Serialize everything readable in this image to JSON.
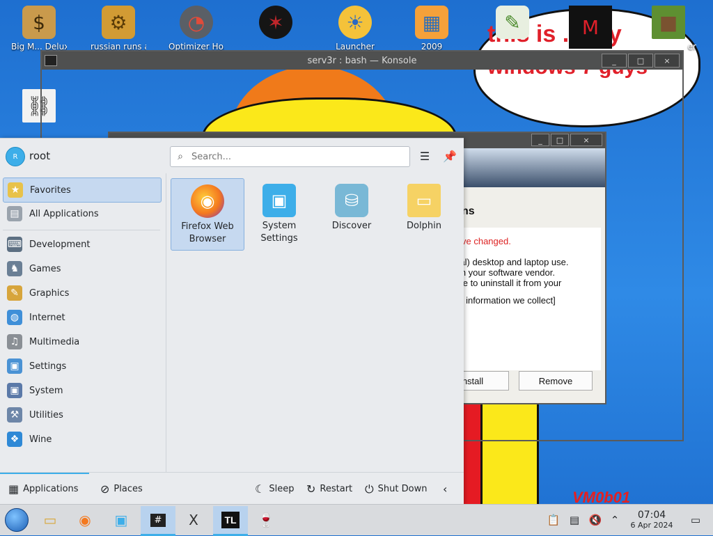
{
  "desktop": {
    "icons": [
      {
        "label": "Big M... Deluxe",
        "glyph": "$",
        "icon": "money-bag-icon"
      },
      {
        "label": "russian runs a...",
        "glyph": "⚙",
        "icon": "gear-icon"
      },
      {
        "label": "Optimizer Ho...",
        "glyph": "◔",
        "icon": "speedometer-icon"
      },
      {
        "label": "Launcher",
        "glyph": "☀",
        "icon": "launcher-icon"
      },
      {
        "label": "2009",
        "glyph": "▦",
        "icon": "office-icon"
      },
      {
        "label": "",
        "glyph": "✎",
        "icon": "notepad-shortcut-icon"
      },
      {
        "label": "",
        "glyph": "M",
        "icon": "media-player-icon"
      },
      {
        "label": "er",
        "glyph": "■",
        "icon": "minecraft-icon"
      },
      {
        "label": "",
        "glyph": "⛓",
        "icon": "shortcut-link-icon"
      }
    ],
    "wallpaper_text_1": "this is ...ally",
    "wallpaper_text_2": "windows 7 guys",
    "watermark": "VM0b01"
  },
  "konsole": {
    "title": "serv3r : bash — Konsole",
    "buttons": [
      "_",
      "□",
      "×"
    ]
  },
  "dialog": {
    "heading": "ns",
    "warning": "ve changed.",
    "body_lines": "cial) desktop and laptop use.\nom your software vendor.\nove to uninstall it from your",
    "info_line": "he information we collect]",
    "install_label": "nstall",
    "remove_label": "Remove"
  },
  "launcher": {
    "user": {
      "initial": "R",
      "name": "root"
    },
    "search": {
      "placeholder": "Search..."
    },
    "categories": [
      {
        "label": "Favorites",
        "icon": "favorites-icon",
        "glyph": "★",
        "color": "#e8c24a",
        "active": true
      },
      {
        "label": "All Applications",
        "icon": "all-apps-icon",
        "glyph": "▤",
        "color": "#9aa3ad",
        "active": false
      },
      {
        "label": "Development",
        "icon": "development-icon",
        "glyph": "⌨",
        "color": "#5c6f82",
        "active": false
      },
      {
        "label": "Games",
        "icon": "games-icon",
        "glyph": "♞",
        "color": "#6a7f95",
        "active": false
      },
      {
        "label": "Graphics",
        "icon": "graphics-icon",
        "glyph": "✎",
        "color": "#d7a53c",
        "active": false
      },
      {
        "label": "Internet",
        "icon": "internet-icon",
        "glyph": "◍",
        "color": "#3f8fd8",
        "active": false
      },
      {
        "label": "Multimedia",
        "icon": "multimedia-icon",
        "glyph": "♫",
        "color": "#8a8f95",
        "active": false
      },
      {
        "label": "Settings",
        "icon": "settings-icon",
        "glyph": "▣",
        "color": "#4a92d4",
        "active": false
      },
      {
        "label": "System",
        "icon": "system-icon",
        "glyph": "▣",
        "color": "#5b79a8",
        "active": false
      },
      {
        "label": "Utilities",
        "icon": "utilities-icon",
        "glyph": "⚒",
        "color": "#6d86a8",
        "active": false
      },
      {
        "label": "Wine",
        "icon": "wine-icon",
        "glyph": "❖",
        "color": "#2f89d6",
        "active": false
      }
    ],
    "favorites": [
      {
        "label": "Firefox Web Browser",
        "icon": "firefox-icon",
        "glyph": "◉",
        "color": "#f4791f",
        "active": true
      },
      {
        "label": "System Settings",
        "icon": "system-settings-icon",
        "glyph": "▣",
        "color": "#3daee9",
        "active": false
      },
      {
        "label": "Discover",
        "icon": "discover-icon",
        "glyph": "⛁",
        "color": "#79b8d6",
        "active": false
      },
      {
        "label": "Dolphin",
        "icon": "dolphin-folder-icon",
        "glyph": "▭",
        "color": "#f6d264",
        "active": false
      }
    ],
    "footer": {
      "applications": "Applications",
      "places": "Places",
      "sleep": "Sleep",
      "restart": "Restart",
      "shutdown": "Shut Down"
    }
  },
  "taskbar": {
    "items": [
      {
        "icon": "start-menu-icon",
        "glyph": ""
      },
      {
        "icon": "file-explorer-icon",
        "glyph": "▭"
      },
      {
        "icon": "firefox-icon",
        "glyph": "◉"
      },
      {
        "icon": "system-monitor-icon",
        "glyph": "▣"
      },
      {
        "icon": "konsole-icon",
        "glyph": "#"
      },
      {
        "icon": "x-app-icon",
        "glyph": "X"
      },
      {
        "icon": "tl-launcher-icon",
        "glyph": "TL"
      },
      {
        "icon": "wine-glass-icon",
        "glyph": "🍷"
      }
    ],
    "clock": {
      "time": "07:04",
      "date": "6 Apr 2024"
    }
  },
  "colors": {
    "accent": "#3daee9",
    "selection": "#c6d9f0",
    "panel": "#e9ebee",
    "titlebar": "#4f5050"
  }
}
